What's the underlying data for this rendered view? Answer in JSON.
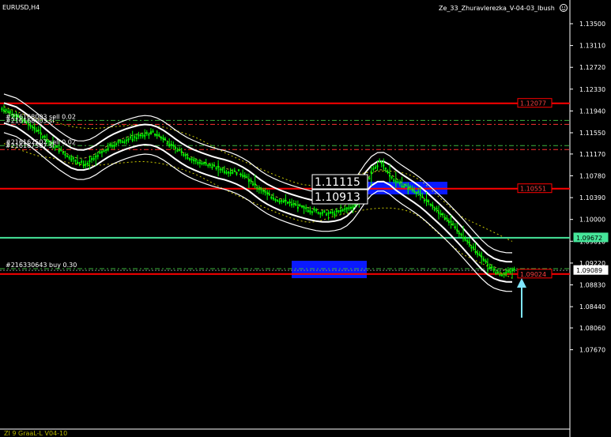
{
  "header": {
    "symbol": "EURUSD,H4",
    "indicator": "Ze_33_Zhuravlerezka_V-04-03_Ibush"
  },
  "footer": {
    "label": "ZI 9 GraaL-L V04-10"
  },
  "colors": {
    "background": "#000000",
    "candles": "#00ff00",
    "bands": "#ffffff",
    "level_line": "#ff0000",
    "current_line": "#46e69a",
    "zone": "#0a1aff",
    "ma_dotted": "#c8c800",
    "arrow": "#7fe6ff"
  },
  "price_axis": {
    "ticks": [
      "1.13500",
      "1.13110",
      "1.12720",
      "1.12330",
      "1.11940",
      "1.11550",
      "1.11170",
      "1.10780",
      "1.10390",
      "1.10000",
      "1.09610",
      "1.09220",
      "1.08830",
      "1.08440",
      "1.08060",
      "1.07670"
    ]
  },
  "price_badges": {
    "upper_level": "1.12077",
    "mid_level": "1.10551",
    "current_level": "1.09672",
    "bid": "1.09089",
    "lower_level": "1.09024"
  },
  "zone_labels": {
    "top": "1.11115",
    "bottom": "1.10913"
  },
  "orders": [
    {
      "text": "#216168003 sell 0.02",
      "price": 1.1177
    },
    {
      "text": "#216168003 sl",
      "price": 1.117
    },
    {
      "text": "#216167507 sell 0.02",
      "price": 1.1132
    },
    {
      "text": "#216167507 sl",
      "price": 1.1125
    },
    {
      "text": "#216330643 buy 0.30",
      "price": 1.0912
    }
  ],
  "chart_data": {
    "type": "line",
    "title": "EURUSD,H4",
    "ylim": [
      1.0747,
      1.1371
    ],
    "levels": [
      1.12077,
      1.10551,
      1.09672,
      1.09024,
      1.09089
    ],
    "close_series": [
      1.1196,
      1.119,
      1.1182,
      1.1175,
      1.1168,
      1.116,
      1.115,
      1.114,
      1.1131,
      1.1122,
      1.1115,
      1.1108,
      1.1102,
      1.1098,
      1.1105,
      1.1114,
      1.1122,
      1.113,
      1.1136,
      1.114,
      1.1143,
      1.1146,
      1.115,
      1.1153,
      1.1155,
      1.115,
      1.1142,
      1.1132,
      1.1124,
      1.1117,
      1.111,
      1.1104,
      1.11,
      1.1098,
      1.1095,
      1.109,
      1.1086,
      1.1084,
      1.1085,
      1.1078,
      1.1068,
      1.1058,
      1.105,
      1.1043,
      1.1037,
      1.1033,
      1.103,
      1.1026,
      1.1022,
      1.1018,
      1.1016,
      1.1014,
      1.1012,
      1.101,
      1.1012,
      1.1016,
      1.102,
      1.1026,
      1.104,
      1.1065,
      1.109,
      1.1102,
      1.109,
      1.1076,
      1.1066,
      1.106,
      1.1056,
      1.105,
      1.104,
      1.103,
      1.102,
      1.101,
      1.1,
      1.099,
      1.0978,
      1.0965,
      1.0952,
      1.094,
      1.0928,
      1.0916,
      1.0906,
      1.0902,
      1.0905,
      1.0909
    ]
  }
}
